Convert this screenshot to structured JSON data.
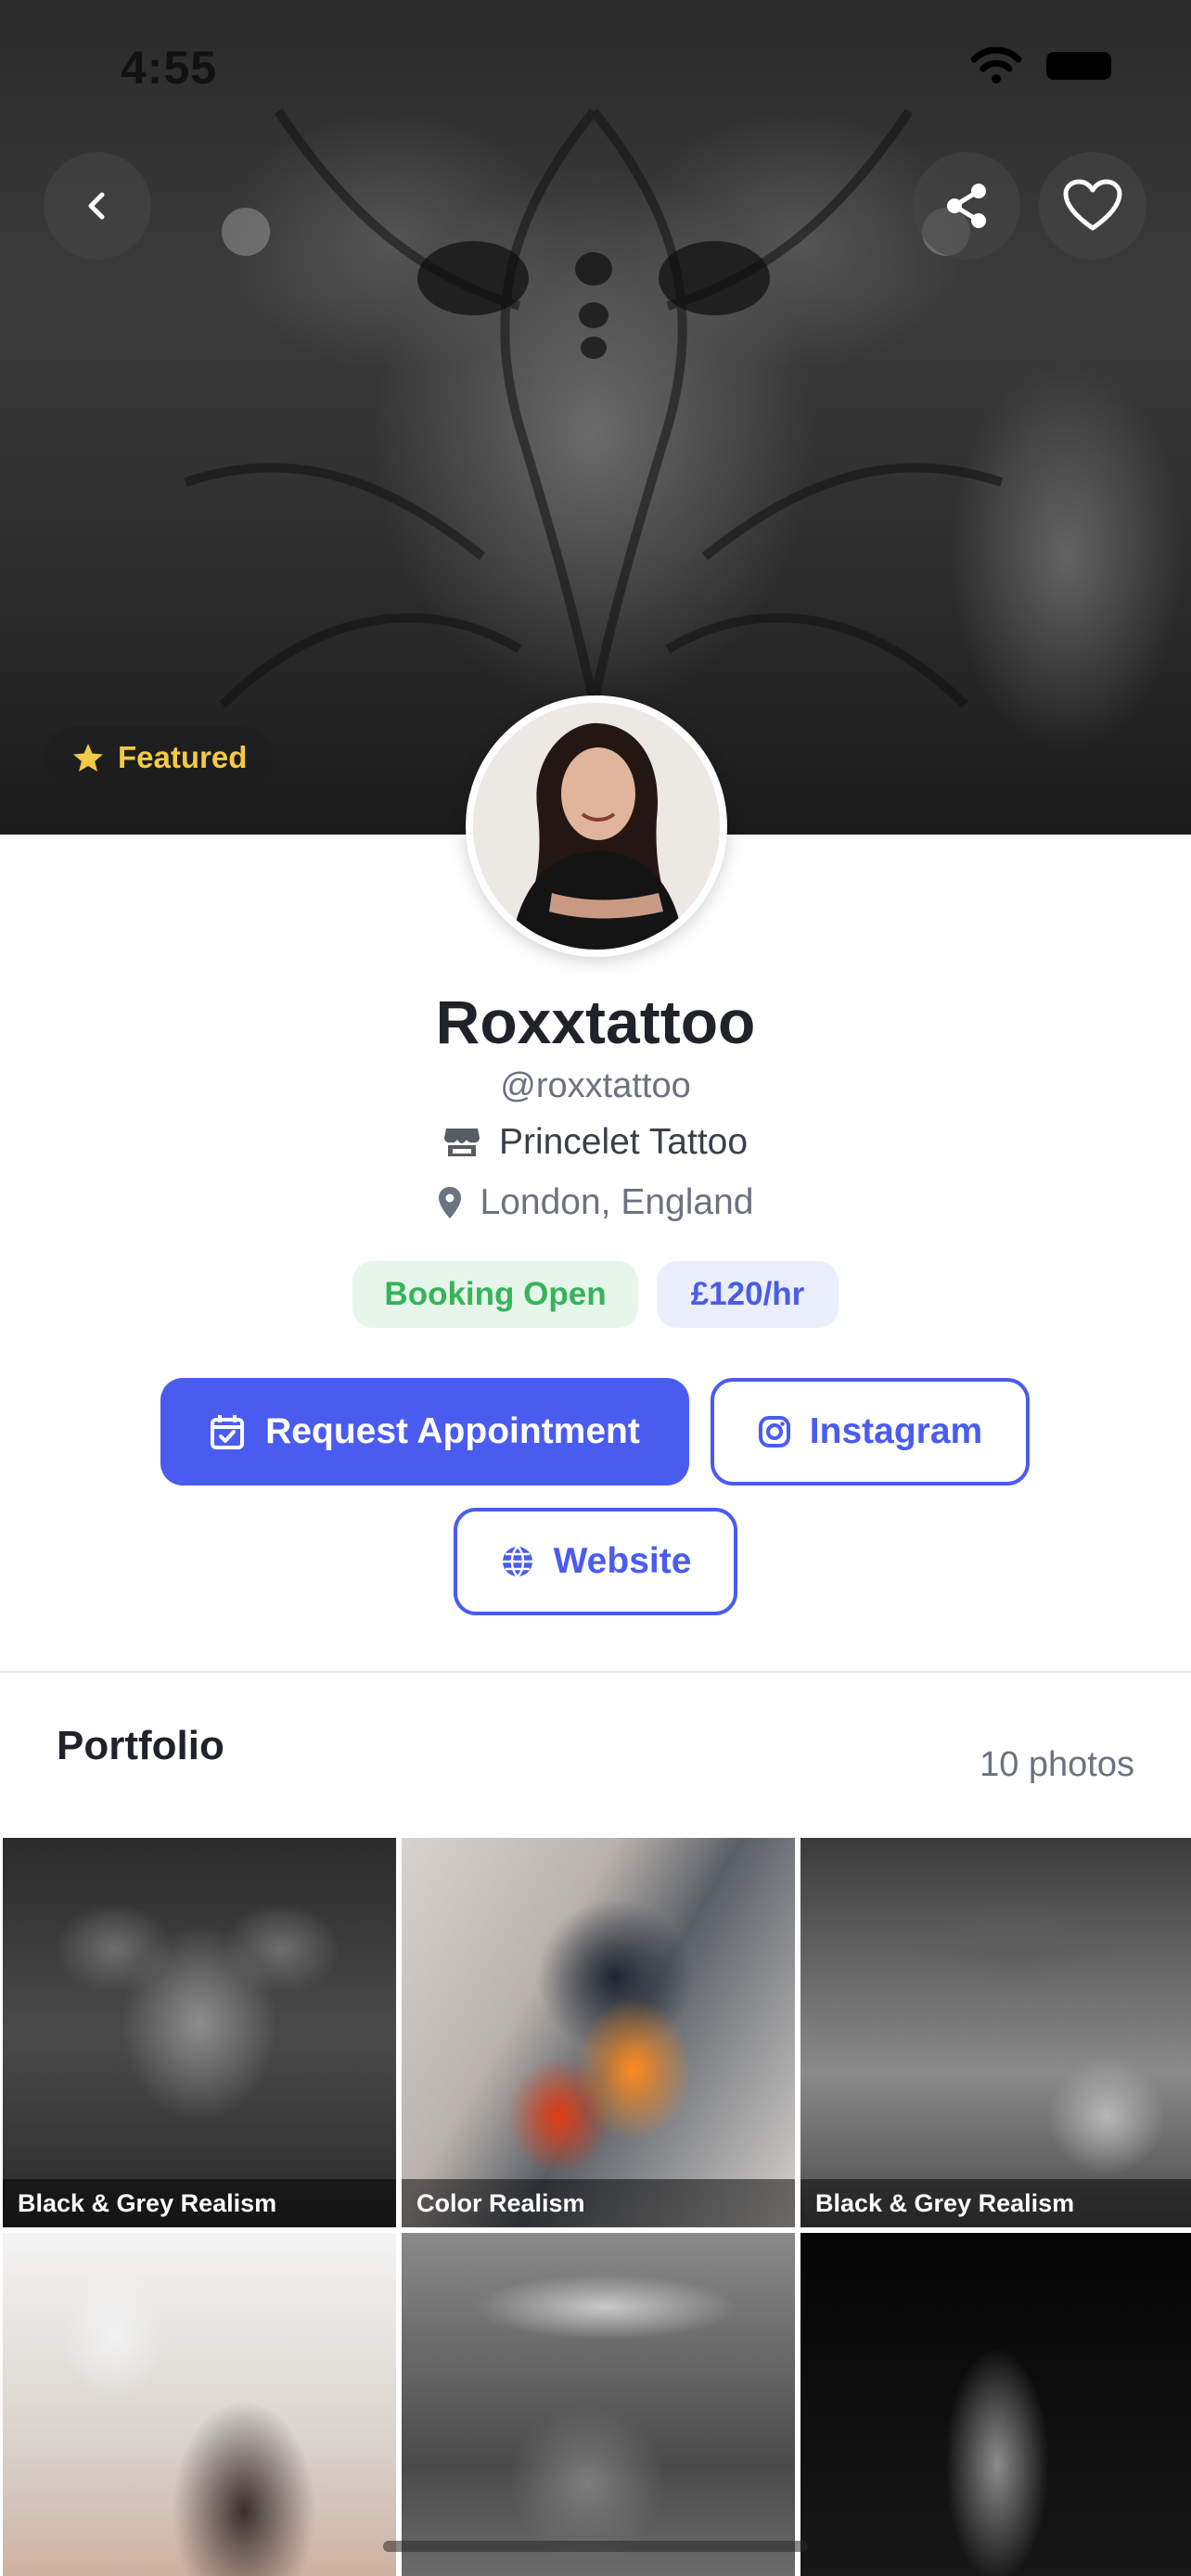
{
  "status_bar": {
    "time": "4:55"
  },
  "hero": {
    "featured_label": "Featured",
    "icons": {
      "back": "chevron-left-icon",
      "share": "share-icon",
      "favorite": "heart-icon",
      "featured": "star-icon"
    }
  },
  "profile": {
    "name": "Roxxtattoo",
    "handle": "@roxxtattoo",
    "studio": "Princelet Tattoo",
    "location": "London, England",
    "booking_status": "Booking Open",
    "rate": "£120/hr"
  },
  "actions": {
    "request_appointment": "Request Appointment",
    "instagram": "Instagram",
    "website": "Website"
  },
  "portfolio": {
    "title": "Portfolio",
    "count": "10 photos",
    "photos": [
      {
        "style": "Black & Grey Realism"
      },
      {
        "style": "Color Realism"
      },
      {
        "style": "Black & Grey Realism"
      },
      {
        "style": ""
      },
      {
        "style": ""
      },
      {
        "style": ""
      }
    ]
  },
  "colors": {
    "accent": "#4a5cf0",
    "booking_green": "#35b459",
    "featured_gold": "#f3c946"
  }
}
